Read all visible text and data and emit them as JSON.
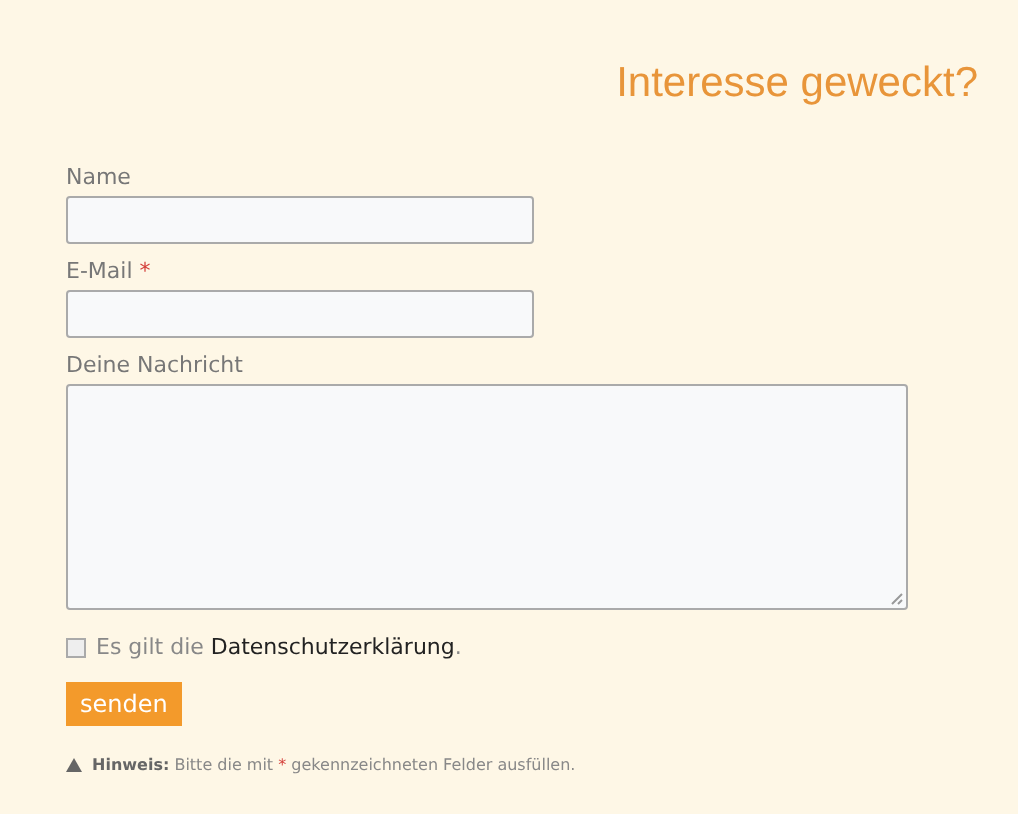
{
  "heading": "Interesse geweckt?",
  "fields": [
    {
      "kind": "input",
      "label": "Name"
    },
    {
      "kind": "input",
      "label": "E-Mail",
      "required_mark": "*"
    },
    {
      "kind": "textarea",
      "label": "Deine Nachricht"
    }
  ],
  "consent": {
    "checked": false,
    "text_before": "Es gilt die",
    "link": "Datenschutzerklärung",
    "text_after": "."
  },
  "submit": "senden",
  "note": {
    "label": "Hinweis:",
    "text_before": "Bitte die mit",
    "marker": "*",
    "text_after": "gekennzeichneten Felder ausfüllen."
  }
}
